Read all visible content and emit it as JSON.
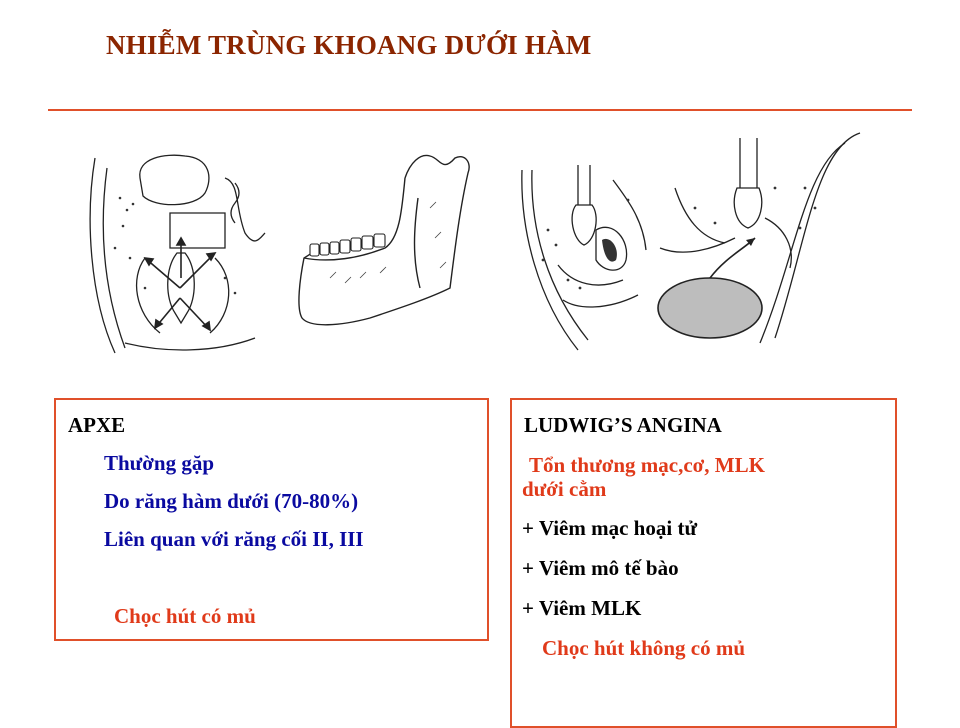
{
  "slide": {
    "title": "NHIỄM TRÙNG KHOANG DƯỚI HÀM"
  },
  "illustrations": [
    {
      "name": "coronal-section-abscess-figure"
    },
    {
      "name": "mandible-figure"
    },
    {
      "name": "sagittal-section-figure"
    },
    {
      "name": "ludwig-angina-section-figure"
    }
  ],
  "apxe_box": {
    "heading": "APXE",
    "line1": "Thường gặp",
    "line2": "Do răng hàm dưới (70-80%)",
    "line3": "Liên quan với răng cối II, III",
    "line4": "Chọc hút có mủ"
  },
  "ludwig_box": {
    "heading": "LUDWIG’S ANGINA",
    "line1a": "Tổn thương mạc,cơ, MLK",
    "line1b": "dưới cằm",
    "item1": "+ Viêm mạc hoại tử",
    "item2": "+ Viêm mô tế bào",
    "item3": "+ Viêm MLK",
    "conclusion": "Chọc hút không có mủ"
  },
  "colors": {
    "title": "#8B2500",
    "rule_and_borders": "#E0502A",
    "blue_text": "#0A0AA0",
    "red_text": "#E03A1A"
  }
}
